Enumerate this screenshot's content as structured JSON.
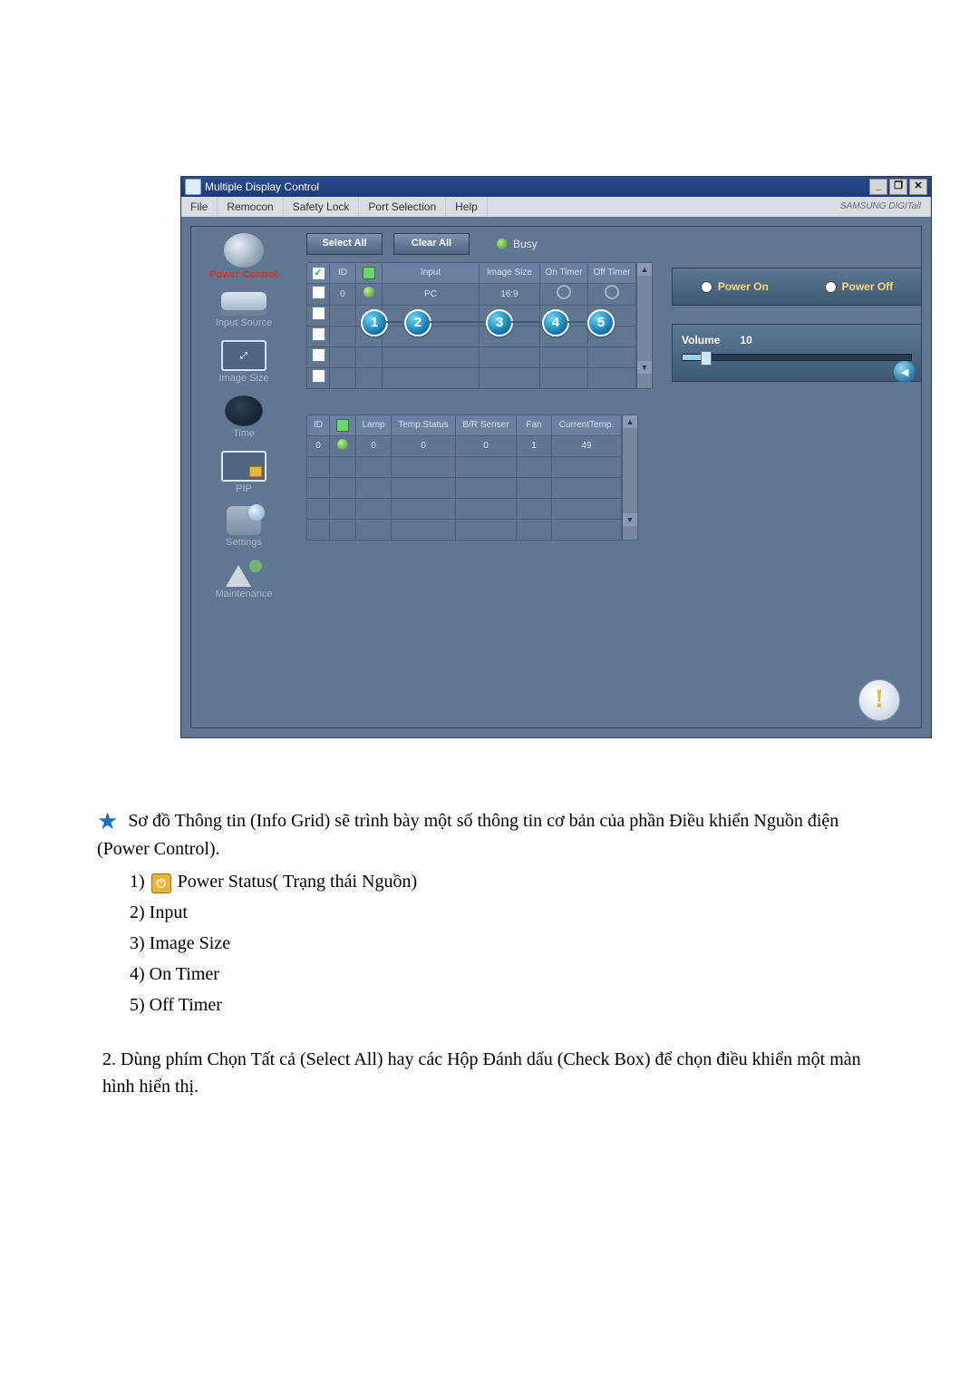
{
  "window": {
    "title": "Multiple Display Control",
    "min": "_",
    "restore": "❐",
    "close": "✕",
    "brand": "SAMSUNG DIGITall"
  },
  "menu": {
    "file": "File",
    "remocon": "Remocon",
    "safety": "Safety Lock",
    "port": "Port Selection",
    "help": "Help"
  },
  "sidebar": {
    "power": "Power Control",
    "input": "Input Source",
    "image": "Image Size",
    "time": "Time",
    "pip": "PIP",
    "settings": "Settings",
    "maint": "Maintenance"
  },
  "toolbar": {
    "select_all": "Select All",
    "clear_all": "Clear All",
    "busy": "Busy"
  },
  "grid1": {
    "headers": {
      "id": "ID",
      "input": "Input",
      "size": "Image Size",
      "on": "On Timer",
      "off": "Off Timer"
    },
    "row": {
      "id": "0",
      "input": "PC",
      "size": "16:9"
    }
  },
  "grid2": {
    "headers": {
      "id": "ID",
      "lamp": "Lamp",
      "temp": "Temp.Status",
      "br": "B/R Senser",
      "fan": "Fan",
      "cur": "CurrentTemp."
    },
    "row": {
      "id": "0",
      "lamp": "0",
      "temp": "0",
      "br": "0",
      "fan": "1",
      "cur": "49"
    }
  },
  "callouts": {
    "c1": "1",
    "c2": "2",
    "c3": "3",
    "c4": "4",
    "c5": "5"
  },
  "power": {
    "on": "Power On",
    "off": "Power Off",
    "vol_label": "Volume",
    "vol_value": "10",
    "speaker": "◄"
  },
  "warn": "!",
  "doc": {
    "intro": "Sơ đồ Thông tin (Info Grid) sẽ trình bày một số thông tin cơ bản của phần Điều khiển Nguồn điện (Power Control).",
    "l1a": "1) ",
    "l1b": " Power Status( Trạng thái Nguồn)",
    "l2": "2) Input",
    "l3": "3) Image Size",
    "l4": "4) On Timer",
    "l5": "5) Off Timer",
    "num2": "2.  Dùng phím Chọn Tất cả (Select All) hay các Hộp Đánh dấu (Check Box) để chọn điều khiển một màn hình hiển thị."
  }
}
